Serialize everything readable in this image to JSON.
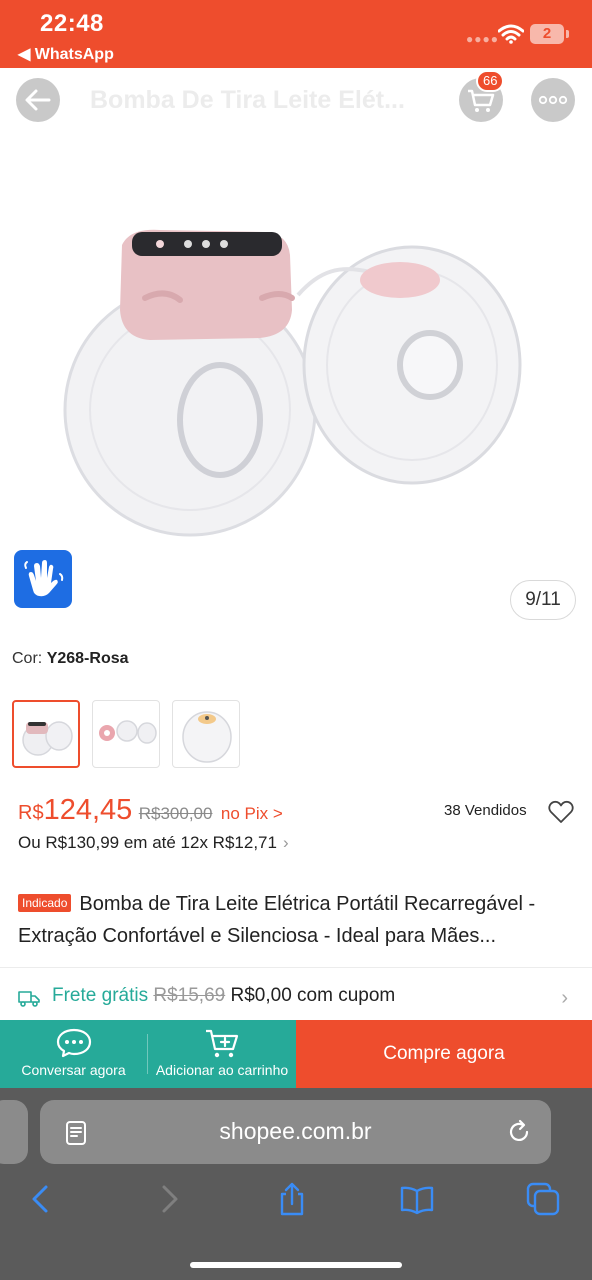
{
  "status_bar": {
    "time": "22:48",
    "back_app": "◀ WhatsApp",
    "battery": "2"
  },
  "header": {
    "title": "Bomba De Tira Leite Elét...",
    "cart_count": "66"
  },
  "gallery": {
    "page_indicator": "9/11"
  },
  "variant": {
    "label": "Cor:",
    "value": "Y268-Rosa"
  },
  "price": {
    "currency": "R$",
    "value": "124,45",
    "original": "R$300,00",
    "pix_label": "no Pix >",
    "sold": "38 Vendidos",
    "installments": "Ou R$130,99 em até 12x R$12,71",
    "installments_chevron": "›"
  },
  "product": {
    "badge": "Indicado",
    "title": "Bomba de Tira Leite Elétrica Portátil Recarregável - Extração Confortável e Silenciosa - Ideal para Mães..."
  },
  "shipping": {
    "free_label": "Frete grátis",
    "old_price": "R$15,69",
    "new_price": "R$0,00 com cupom",
    "chevron": "›"
  },
  "actions": {
    "chat_label": "Conversar agora",
    "cart_label": "Adicionar ao carrinho",
    "buy_label": "Compre agora"
  },
  "browser": {
    "url": "shopee.com.br"
  },
  "colors": {
    "brand": "#ee4d2d",
    "teal": "#26aa99",
    "accessibility": "#1e6de3",
    "browser_blue": "#3a8cf5"
  },
  "icons": [
    "wifi-icon",
    "back-arrow-icon",
    "cart-icon",
    "more-icon",
    "accessibility-hand-icon",
    "heart-icon",
    "truck-icon",
    "chat-icon",
    "add-to-cart-icon",
    "page-menu-icon",
    "reload-icon",
    "browser-back-icon",
    "browser-forward-icon",
    "share-icon",
    "bookmarks-icon",
    "tabs-icon"
  ]
}
